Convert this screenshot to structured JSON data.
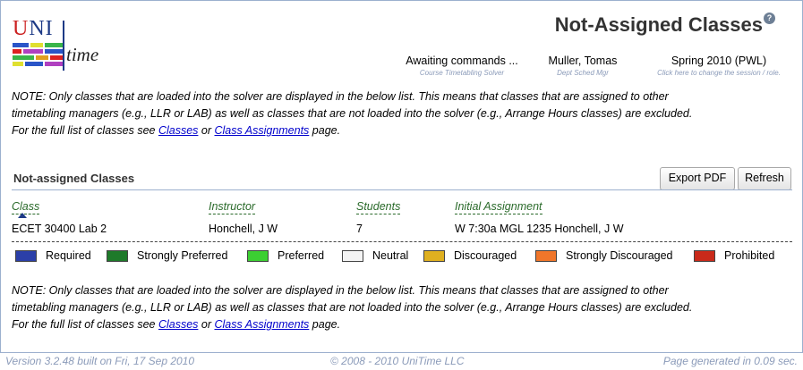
{
  "logo": {
    "uni_u": "U",
    "uni_ni": "NI",
    "time": "time"
  },
  "page_title": "Not-Assigned Classes",
  "help_icon_glyph": "?",
  "header": {
    "status": {
      "value": "Awaiting commands ...",
      "sub": "Course Timetabling Solver"
    },
    "user": {
      "value": "Muller, Tomas",
      "sub": "Dept Sched Mgr"
    },
    "session": {
      "value": "Spring 2010 (PWL)",
      "sub": "Click here to change the session / role."
    }
  },
  "note": {
    "line1": "NOTE: Only classes that are loaded into the solver are displayed in the below list. This means that classes that are assigned to other",
    "line2": "timetabling managers (e.g., LLR or LAB) as well as classes that are not loaded into the solver (e.g., Arrange Hours classes) are excluded.",
    "line3_prefix": "For the full list of classes see ",
    "link_classes": "Classes",
    "or": " or ",
    "link_assignments": "Class Assignments",
    "line3_suffix": " page."
  },
  "section": {
    "title": "Not-assigned Classes",
    "export_label": "Export PDF",
    "refresh_label": "Refresh"
  },
  "table": {
    "headers": {
      "class": "Class",
      "instructor": "Instructor",
      "students": "Students",
      "initial": "Initial Assignment"
    },
    "rows": [
      {
        "class": "ECET 30400 Lab 2",
        "instructor": "Honchell, J W",
        "students": "7",
        "initial": "W 7:30a MGL 1235 Honchell, J W"
      }
    ]
  },
  "legend": [
    {
      "label": "Required",
      "color": "#2b3fa8"
    },
    {
      "label": "Strongly Preferred",
      "color": "#1e7a2a"
    },
    {
      "label": "Preferred",
      "color": "#3ccf32"
    },
    {
      "label": "Neutral",
      "color": "#f4f4f4"
    },
    {
      "label": "Discouraged",
      "color": "#dfb020"
    },
    {
      "label": "Strongly Discouraged",
      "color": "#f0762a"
    },
    {
      "label": "Prohibited",
      "color": "#c92a1a"
    }
  ],
  "footer": {
    "version": "Version 3.2.48 built on Fri, 17 Sep 2010",
    "copyright": "© 2008 - 2010 UniTime LLC",
    "generated": "Page generated in 0.09 sec."
  }
}
